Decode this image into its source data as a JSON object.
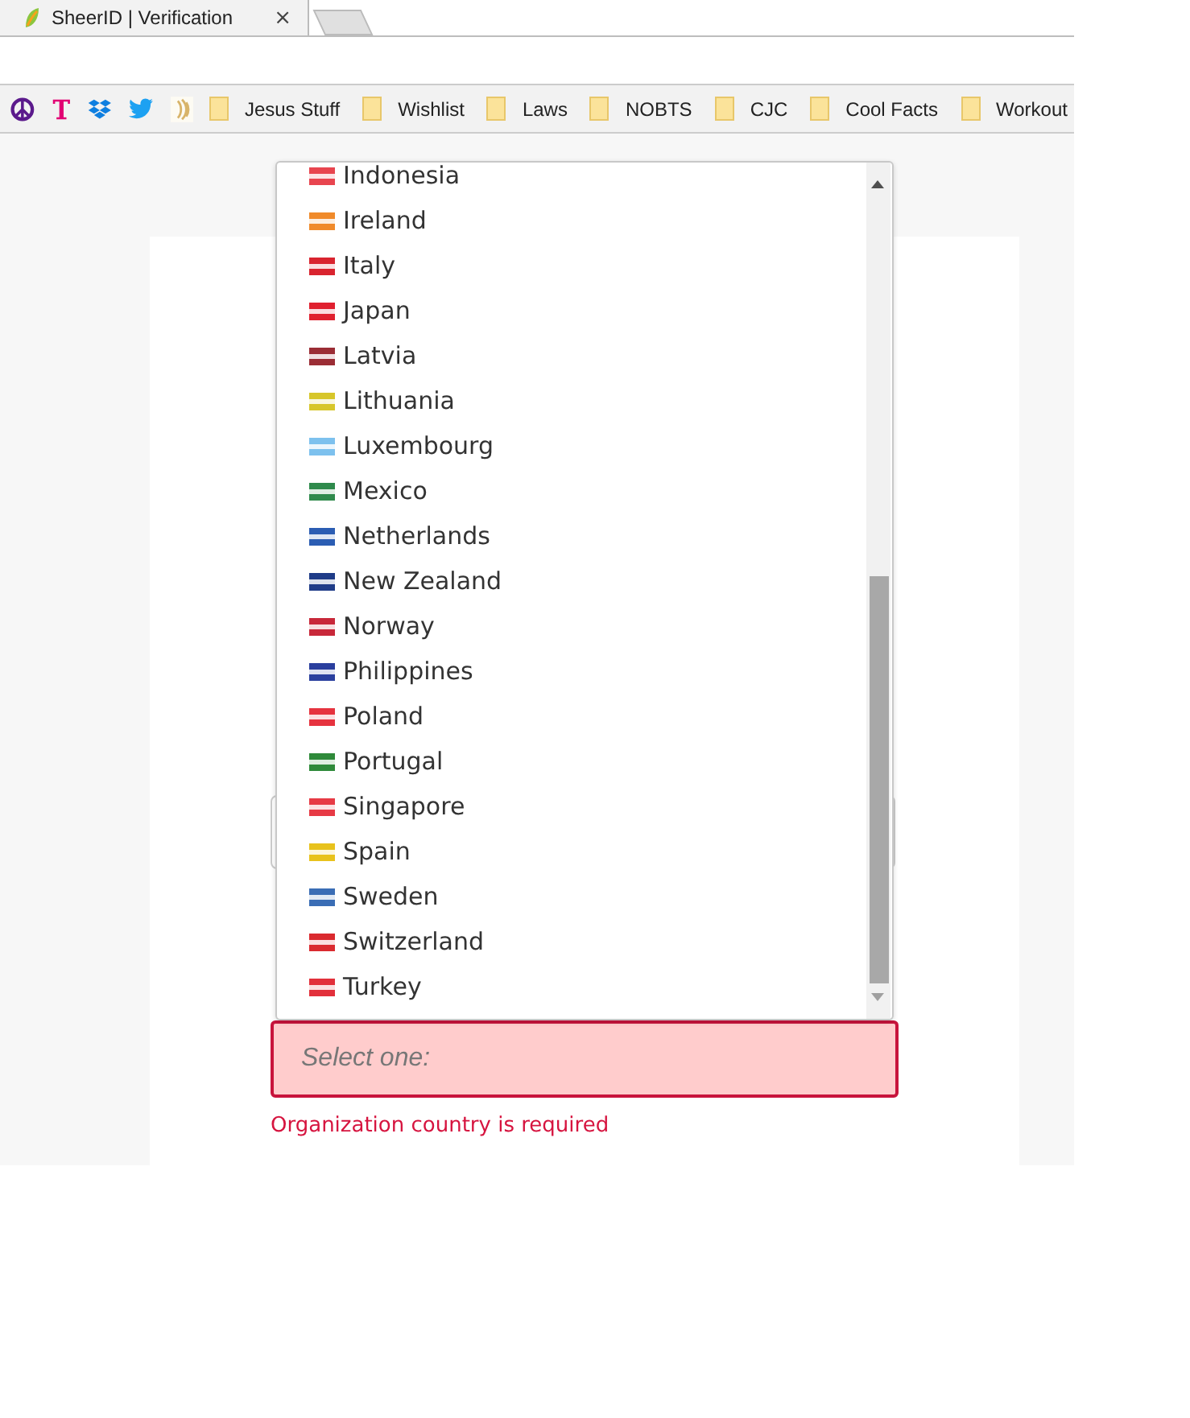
{
  "tab": {
    "title": "SheerID | Verification",
    "close": "×"
  },
  "bookmarks": [
    {
      "label": "Jesus Stuff"
    },
    {
      "label": "Wishlist"
    },
    {
      "label": "Laws"
    },
    {
      "label": "NOBTS"
    },
    {
      "label": "CJC"
    },
    {
      "label": "Cool Facts"
    },
    {
      "label": "Workout"
    }
  ],
  "dropdown": {
    "options": [
      {
        "label": "Indonesia",
        "color": "#e8454f"
      },
      {
        "label": "Ireland",
        "color": "#f08a2a"
      },
      {
        "label": "Italy",
        "color": "#d9242f"
      },
      {
        "label": "Japan",
        "color": "#e0202f"
      },
      {
        "label": "Latvia",
        "color": "#9b2d35"
      },
      {
        "label": "Lithuania",
        "color": "#d7c62a"
      },
      {
        "label": "Luxembourg",
        "color": "#7dc1ee"
      },
      {
        "label": "Mexico",
        "color": "#2f8a4c"
      },
      {
        "label": "Netherlands",
        "color": "#2b5db3"
      },
      {
        "label": "New Zealand",
        "color": "#1f3c88"
      },
      {
        "label": "Norway",
        "color": "#c8283a"
      },
      {
        "label": "Philippines",
        "color": "#2a3f9e"
      },
      {
        "label": "Poland",
        "color": "#e6333f"
      },
      {
        "label": "Portugal",
        "color": "#2f8a3a"
      },
      {
        "label": "Singapore",
        "color": "#e73a45"
      },
      {
        "label": "Spain",
        "color": "#e8c21c"
      },
      {
        "label": "Sweden",
        "color": "#3a6db5"
      },
      {
        "label": "Switzerland",
        "color": "#da2a2f"
      },
      {
        "label": "Turkey",
        "color": "#e2303b"
      }
    ]
  },
  "country_field": {
    "placeholder": "Select one:",
    "error": "Organization country is required"
  }
}
